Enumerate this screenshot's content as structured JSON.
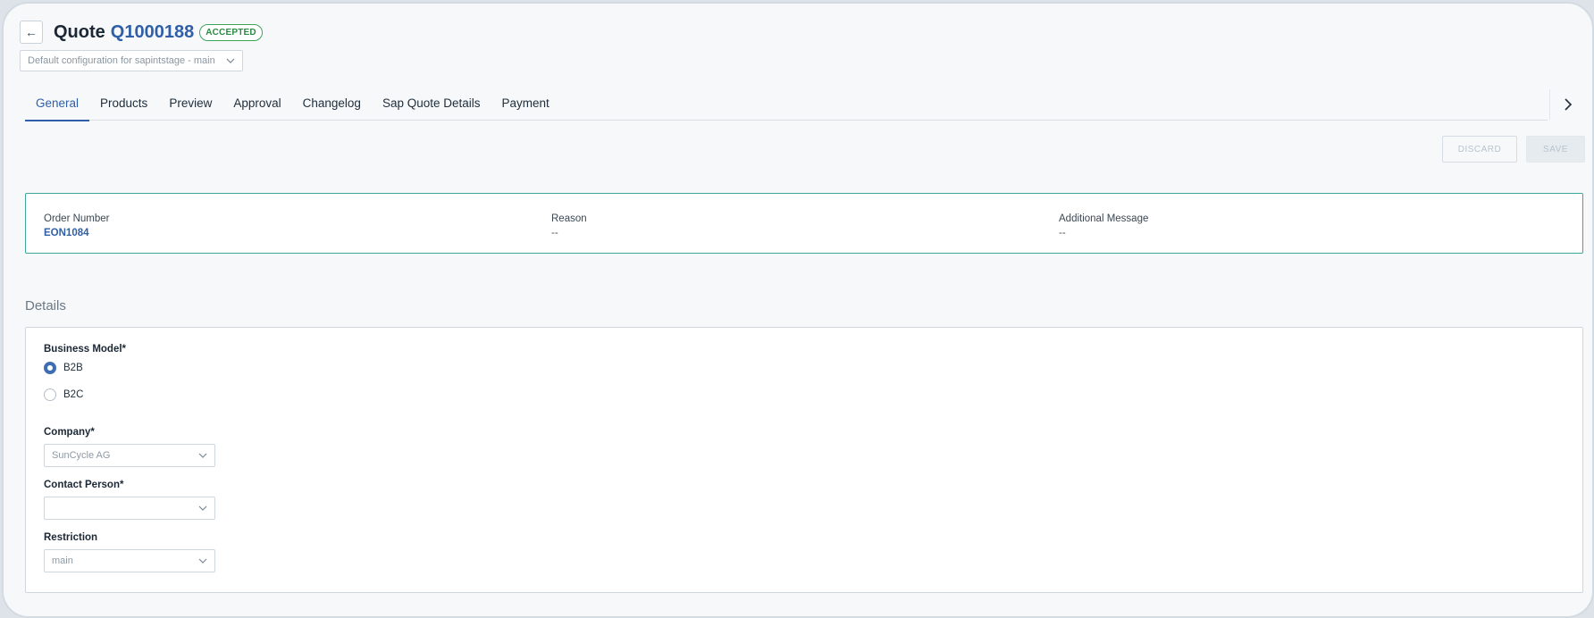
{
  "header": {
    "title": "Quote",
    "quote_id": "Q1000188",
    "status_badge": "ACCEPTED"
  },
  "configuration": {
    "selected": "Default configuration for sapintstage - main"
  },
  "tabs": [
    {
      "label": "General",
      "active": true
    },
    {
      "label": "Products"
    },
    {
      "label": "Preview"
    },
    {
      "label": "Approval"
    },
    {
      "label": "Changelog"
    },
    {
      "label": "Sap Quote Details"
    },
    {
      "label": "Payment"
    }
  ],
  "actions": {
    "discard_label": "DISCARD",
    "save_label": "SAVE"
  },
  "order_info": {
    "order_number_label": "Order Number",
    "order_number_value": "EON1084",
    "reason_label": "Reason",
    "reason_value": "--",
    "additional_message_label": "Additional Message",
    "additional_message_value": "--"
  },
  "details": {
    "section_title": "Details",
    "business_model_label": "Business Model*",
    "business_model_options": [
      {
        "label": "B2B",
        "checked": true
      },
      {
        "label": "B2C",
        "checked": false
      }
    ],
    "company_label": "Company*",
    "company_value": "SunCycle AG",
    "contact_person_label": "Contact Person*",
    "contact_person_value": "",
    "contact_person_email": "",
    "restriction_label": "Restriction",
    "restriction_value": "main"
  },
  "colors": {
    "accent": "#2f5fa8",
    "accepted_badge": "#2c8a45",
    "order_box_border": "#3da79e"
  },
  "icons": {
    "back": "arrow-left-icon",
    "dropdown": "chevron-down-icon",
    "scroll": "chevron-right-icon"
  }
}
